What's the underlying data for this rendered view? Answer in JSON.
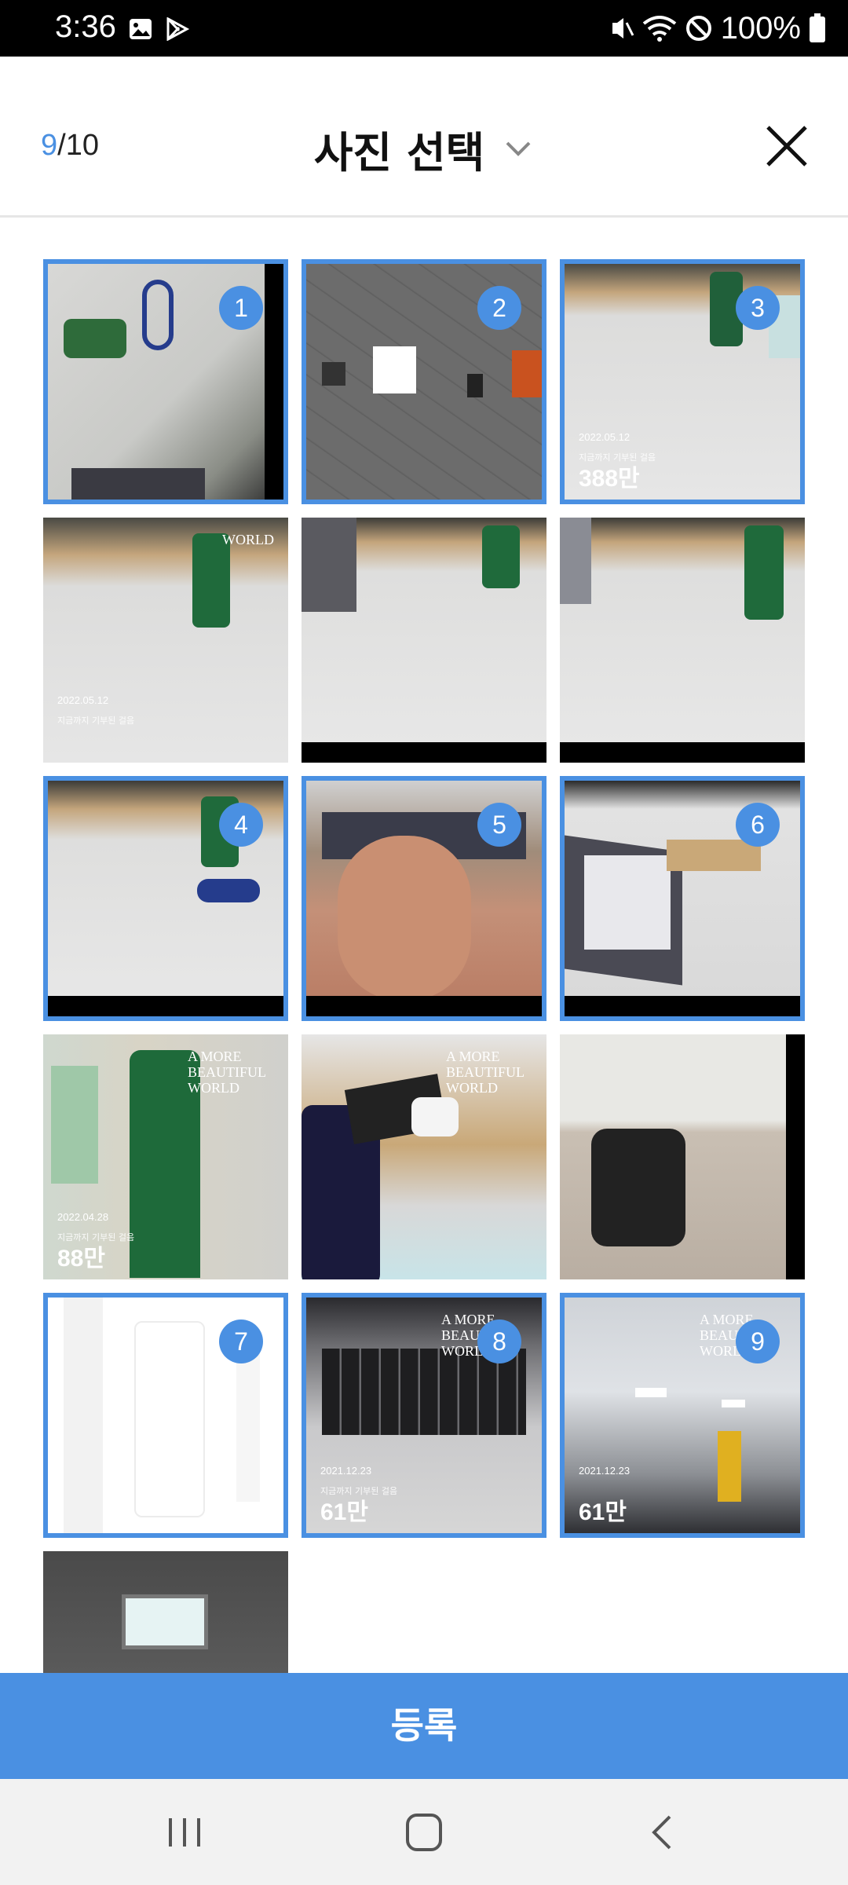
{
  "status_bar": {
    "time": "3:36",
    "battery": "100%",
    "left_icons": [
      "gallery-notification-icon",
      "play-store-icon"
    ],
    "right_icons": [
      "vibrate-icon",
      "wifi-icon",
      "do-not-disturb-icon",
      "battery-icon"
    ]
  },
  "header": {
    "count_current": "9",
    "count_total": "/10",
    "title": "사진 선택",
    "dropdown_icon": "chevron-down-icon",
    "close_icon": "close-icon"
  },
  "accent_color": "#4a90e2",
  "photos": [
    {
      "selected": true,
      "badge": "1"
    },
    {
      "selected": true,
      "badge": "2"
    },
    {
      "selected": true,
      "badge": "3",
      "date": "2022.05.12",
      "sub": "지금까지 기부된 걸음",
      "value": "388만"
    },
    {
      "selected": false,
      "logo": "WORLD",
      "date": "2022.05.12",
      "sub": "지금까지 기부된 걸음"
    },
    {
      "selected": false
    },
    {
      "selected": false
    },
    {
      "selected": true,
      "badge": "4"
    },
    {
      "selected": true,
      "badge": "5"
    },
    {
      "selected": true,
      "badge": "6"
    },
    {
      "selected": false,
      "logo": "A MORE BEAUTIFUL WORLD",
      "date": "2022.04.28",
      "sub": "지금까지 기부된 걸음",
      "value": "88만"
    },
    {
      "selected": false,
      "logo": "A MORE BEAUTIFUL WORLD"
    },
    {
      "selected": false
    },
    {
      "selected": true,
      "badge": "7"
    },
    {
      "selected": true,
      "badge": "8",
      "logo": "A MORE BEAUTIFUL WORLD",
      "date": "2021.12.23",
      "sub": "지금까지 기부된 걸음",
      "value": "61만"
    },
    {
      "selected": true,
      "badge": "9",
      "logo": "A MORE BEAUTIFUL WORLD",
      "date": "2021.12.23",
      "value": "61만"
    },
    {
      "selected": false
    }
  ],
  "register_button": "등록",
  "nav": {
    "recents_icon": "recents-icon",
    "home_icon": "home-icon",
    "back_icon": "back-icon"
  }
}
